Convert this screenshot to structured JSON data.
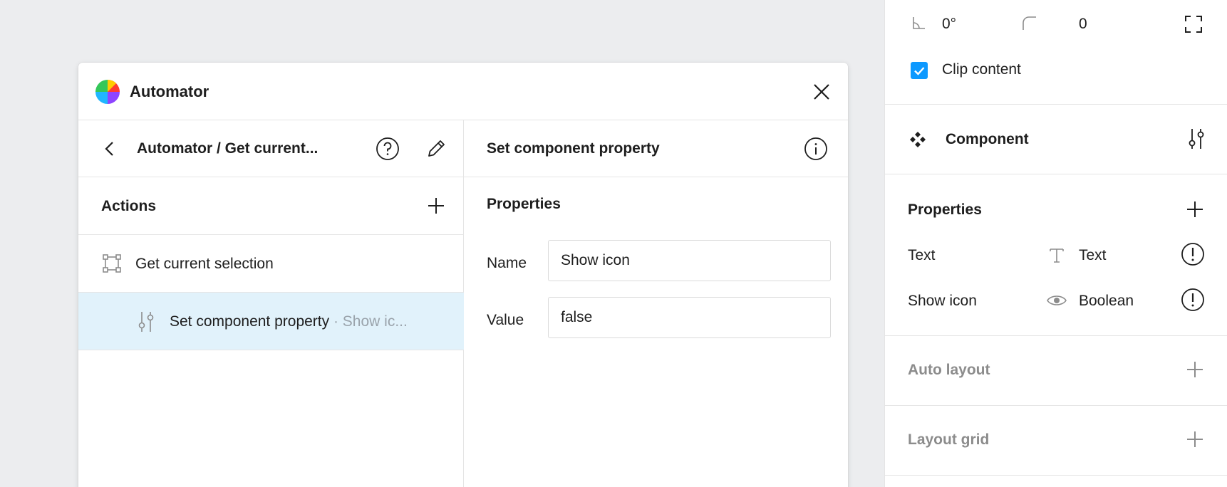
{
  "plugin": {
    "title": "Automator",
    "breadcrumb": "Automator / Get current...",
    "actions_title": "Actions",
    "actions": [
      {
        "label": "Get current selection",
        "sub": ""
      },
      {
        "label": "Set component property",
        "sub": " · Show ic..."
      }
    ],
    "detail": {
      "title": "Set component property",
      "properties_title": "Properties",
      "fields": [
        {
          "label": "Name",
          "value": "Show icon"
        },
        {
          "label": "Value",
          "value": "false"
        }
      ]
    }
  },
  "panel": {
    "rotation": "0°",
    "corner_radius": "0",
    "clip_content_label": "Clip content",
    "clip_content_checked": true,
    "component_title": "Component",
    "properties_title": "Properties",
    "properties": [
      {
        "name": "Text",
        "type": "Text",
        "type_icon": "text-type-icon"
      },
      {
        "name": "Show icon",
        "type": "Boolean",
        "type_icon": "eye-icon"
      }
    ],
    "auto_layout_title": "Auto layout",
    "layout_grid_title": "Layout grid"
  },
  "colors": {
    "accent": "#0D99FF",
    "selected_row": "#E1F2FB",
    "canvas": "#ECEDEF",
    "muted_text": "#9AA3AB"
  }
}
